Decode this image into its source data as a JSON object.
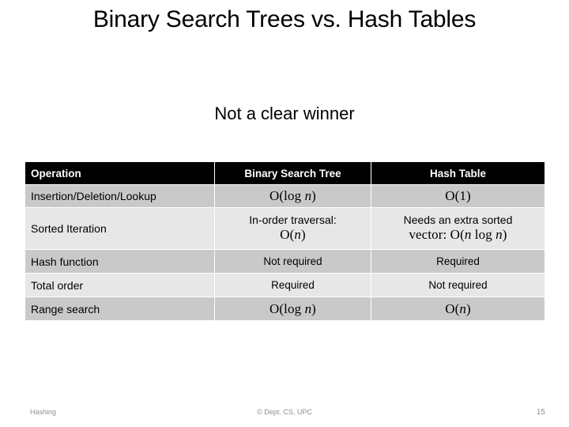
{
  "slide": {
    "title": "Binary Search Trees vs. Hash Tables",
    "subtitle": "Not a clear winner"
  },
  "table": {
    "headers": {
      "operation": "Operation",
      "bst": "Binary Search Tree",
      "hash": "Hash Table"
    },
    "rows": [
      {
        "operation": "Insertion/Deletion/Lookup",
        "bst_prefix": "",
        "bst_math_a": "O(log ",
        "bst_var_a": "n",
        "bst_math_b": ")",
        "hash_prefix": "",
        "hash_math_a": "O(1)",
        "hash_var_a": "",
        "hash_math_b": ""
      },
      {
        "operation": "Sorted Iteration",
        "bst_prefix": "In-order traversal:",
        "bst_math_a": "O(",
        "bst_var_a": "n",
        "bst_math_b": ")",
        "hash_prefix": "Needs an extra sorted",
        "hash_math_a": "vector: O(",
        "hash_var_a": "n",
        "hash_math_b": " log ",
        "hash_var_b": "n",
        "hash_math_c": ")"
      },
      {
        "operation": "Hash function",
        "bst_text": "Not required",
        "hash_text": "Required"
      },
      {
        "operation": "Total order",
        "bst_text": "Required",
        "hash_text": "Not required"
      },
      {
        "operation": "Range search",
        "bst_math_a": "O(log ",
        "bst_var_a": "n",
        "bst_math_b": ")",
        "hash_math_a": "O(",
        "hash_var_a": "n",
        "hash_math_b": ")"
      }
    ]
  },
  "footer": {
    "left": "Hashing",
    "center": "© Dept. CS, UPC",
    "page": "15"
  },
  "colors": {
    "header_bg": "#000000",
    "header_fg": "#ffffff",
    "band_dark": "#c9c9c9",
    "band_light": "#e7e7e7",
    "text": "#000000",
    "footer_text": "#8f8f8f",
    "slide_bg": "#ffffff"
  }
}
